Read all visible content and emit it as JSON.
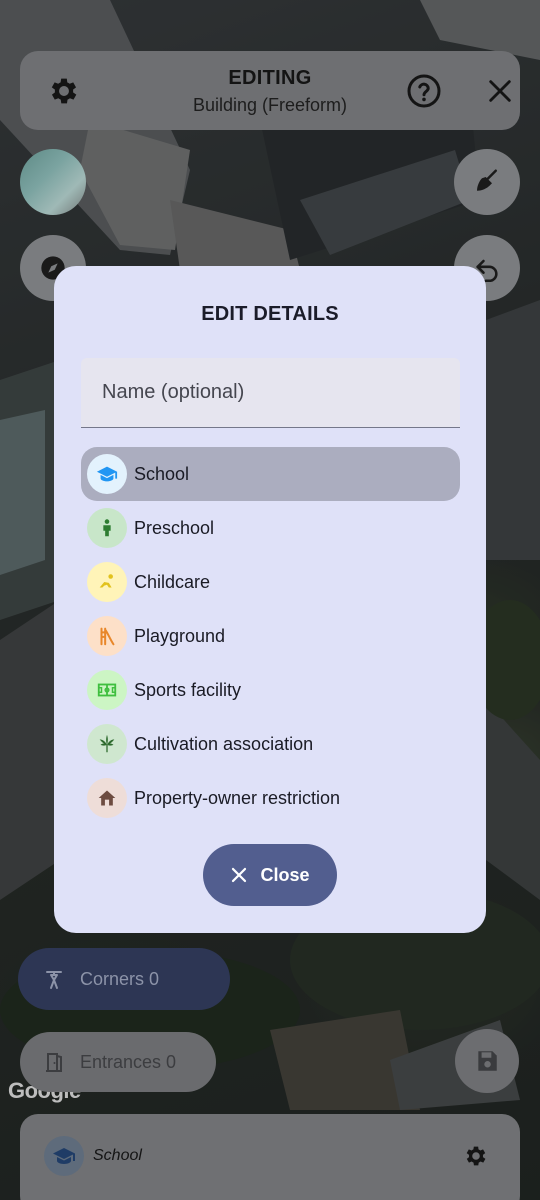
{
  "header": {
    "title": "EDITING",
    "subtitle": "Building (Freeform)"
  },
  "map": {
    "attribution": "Google"
  },
  "dialog": {
    "title": "EDIT DETAILS",
    "name_placeholder": "Name (optional)",
    "name_value": "",
    "categories": [
      {
        "label": "School",
        "icon": "graduation-cap-icon",
        "icon_color": "#2196f3",
        "icon_bg": "#e3f2fd",
        "selected": true
      },
      {
        "label": "Preschool",
        "icon": "child-icon",
        "icon_color": "#2e7d32",
        "icon_bg": "#c8e6c9",
        "selected": false
      },
      {
        "label": "Childcare",
        "icon": "baby-crawl-icon",
        "icon_color": "#e2c21c",
        "icon_bg": "#fff4b8",
        "selected": false
      },
      {
        "label": "Playground",
        "icon": "slide-icon",
        "icon_color": "#e8872a",
        "icon_bg": "#fde0c8",
        "selected": false
      },
      {
        "label": "Sports facility",
        "icon": "stadium-icon",
        "icon_color": "#3fbf3f",
        "icon_bg": "#ccf5c4",
        "selected": false
      },
      {
        "label": "Cultivation association",
        "icon": "leaf-icon",
        "icon_color": "#2f6b2f",
        "icon_bg": "#cfe7cf",
        "selected": false
      },
      {
        "label": "Property-owner restriction",
        "icon": "house-icon",
        "icon_color": "#6d4c41",
        "icon_bg": "#eeddd8",
        "selected": false
      }
    ],
    "close_label": "Close"
  },
  "corners": {
    "label": "Corners 0"
  },
  "entrances": {
    "label": "Entrances 0"
  },
  "bottom_bar": {
    "category_label": "School",
    "category_icon": "graduation-cap-icon"
  },
  "colors": {
    "dialog_bg": "#dfe1f8",
    "primary": "#525e8f",
    "selected_row": "#abadbf",
    "corners_bg": "#2d3654"
  }
}
